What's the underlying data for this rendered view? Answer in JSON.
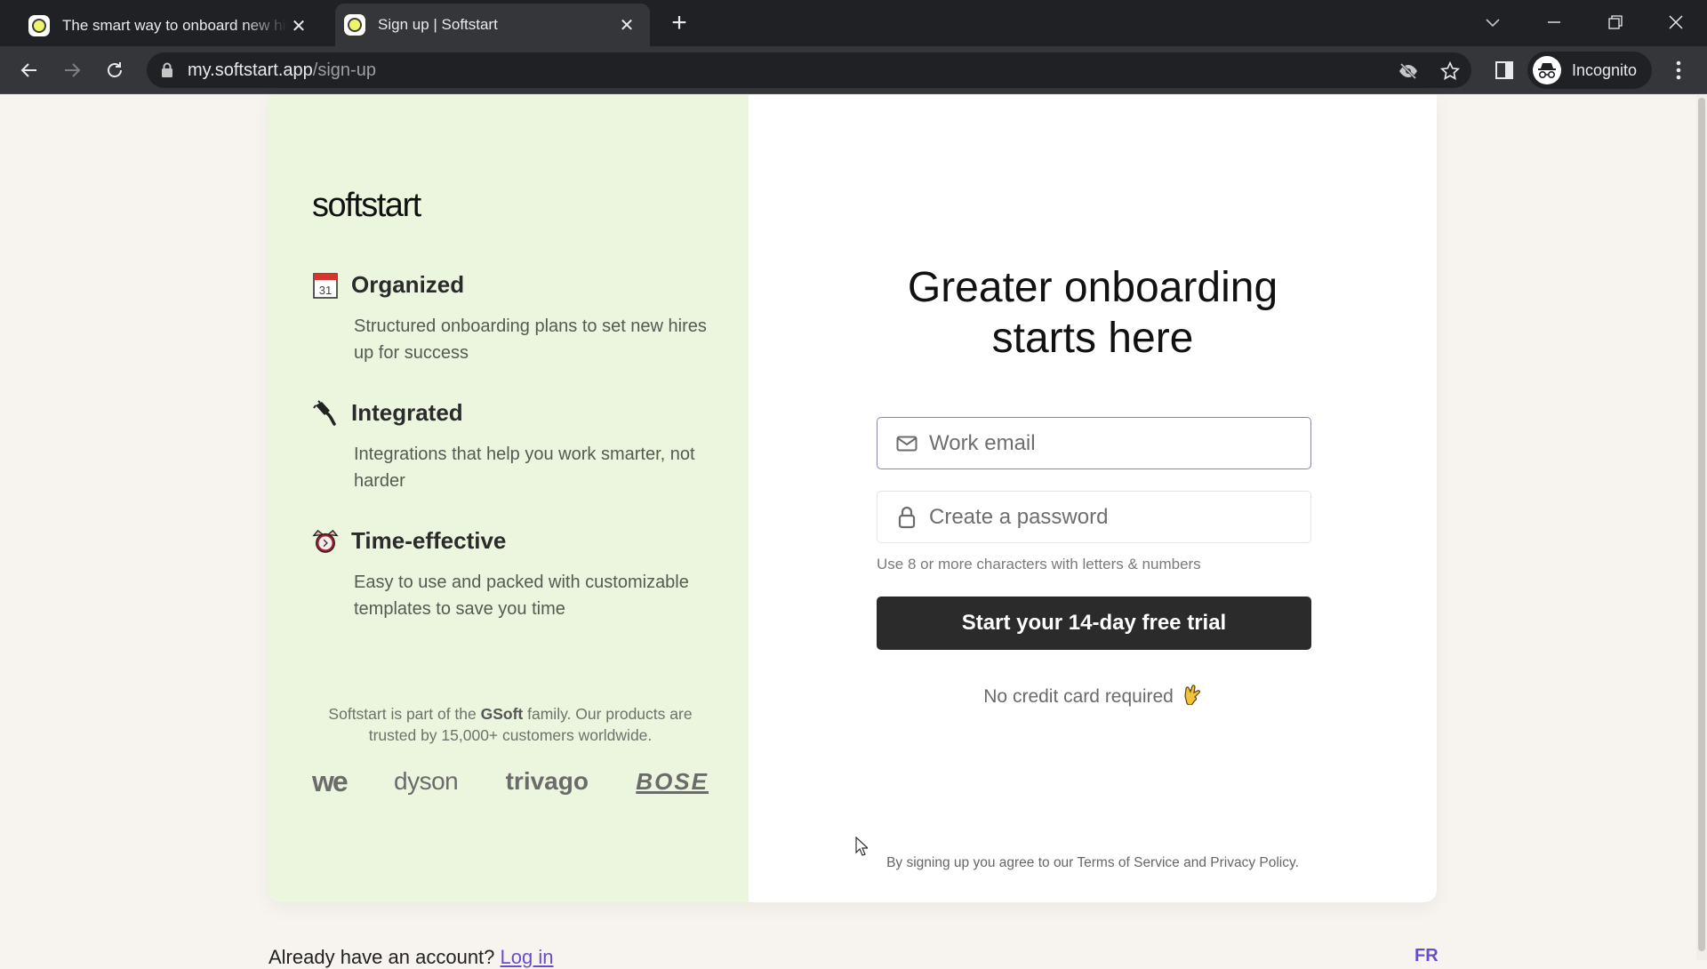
{
  "browser": {
    "tabs": [
      {
        "title": "The smart way to onboard new hires",
        "active": false
      },
      {
        "title": "Sign up | Softstart",
        "active": true
      }
    ],
    "new_tab_label": "+",
    "url_host": "my.softstart.app",
    "url_path": "/sign-up",
    "profile_label": "Incognito"
  },
  "left": {
    "logo": "softstart",
    "features": [
      {
        "icon": "calendar-icon",
        "glyph_text": "31",
        "title": "Organized",
        "desc": "Structured onboarding plans to set new hires up for success"
      },
      {
        "icon": "plug-icon",
        "title": "Integrated",
        "desc": "Integrations that help you work smarter, not harder"
      },
      {
        "icon": "alarm-clock-icon",
        "title": "Time-effective",
        "desc": "Easy to use and packed with customizable templates to save you time"
      }
    ],
    "gsoft_before": "Softstart is part of the ",
    "gsoft_bold": "GSoft",
    "gsoft_after": " family. Our products are trusted by 15,000+ customers worldwide.",
    "customer_logos": [
      "we",
      "dyson",
      "trivago",
      "BOSE"
    ]
  },
  "form": {
    "headline_line1": "Greater onboarding",
    "headline_line2": "starts here",
    "email_placeholder": "Work email",
    "email_value": "",
    "password_placeholder": "Create a password",
    "password_value": "",
    "password_hint": "Use 8 or more characters with letters & numbers",
    "submit_label": "Start your 14-day free trial",
    "no_credit_card": "No credit card required",
    "legal_text": "By signing up you agree to our Terms of Service and Privacy Policy."
  },
  "footer": {
    "account_prompt": "Already have an account?",
    "login_link": "Log in",
    "language": "FR"
  }
}
